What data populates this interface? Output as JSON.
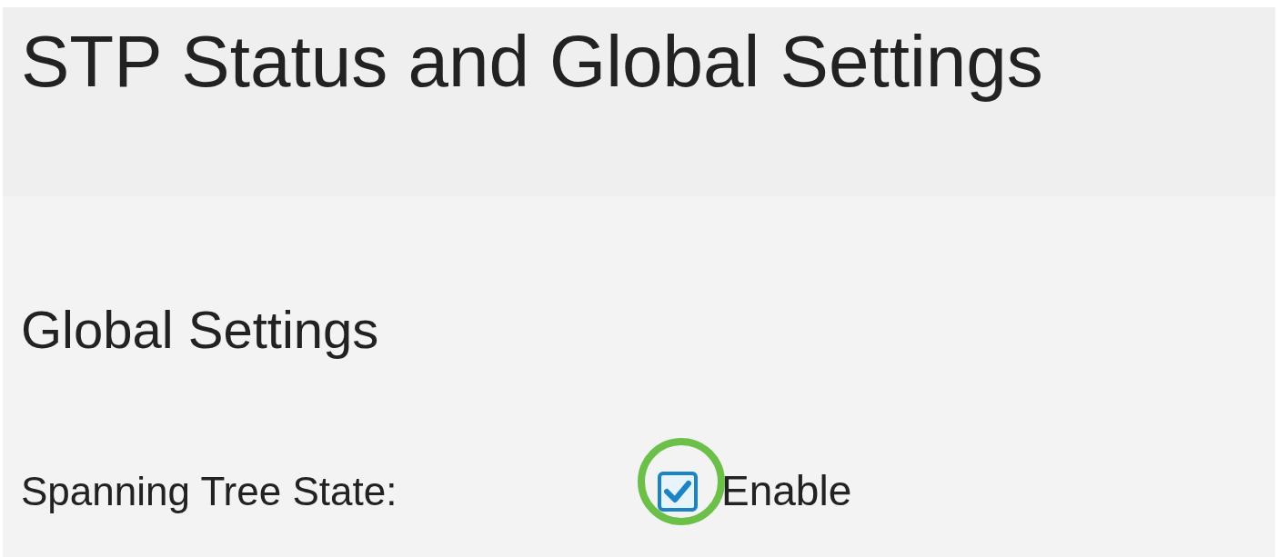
{
  "page": {
    "title": "STP Status and Global Settings"
  },
  "section": {
    "title": "Global Settings"
  },
  "settings": [
    {
      "label": "Spanning Tree State:",
      "checked": true,
      "highlighted": true,
      "option_label": "Enable"
    }
  ]
}
